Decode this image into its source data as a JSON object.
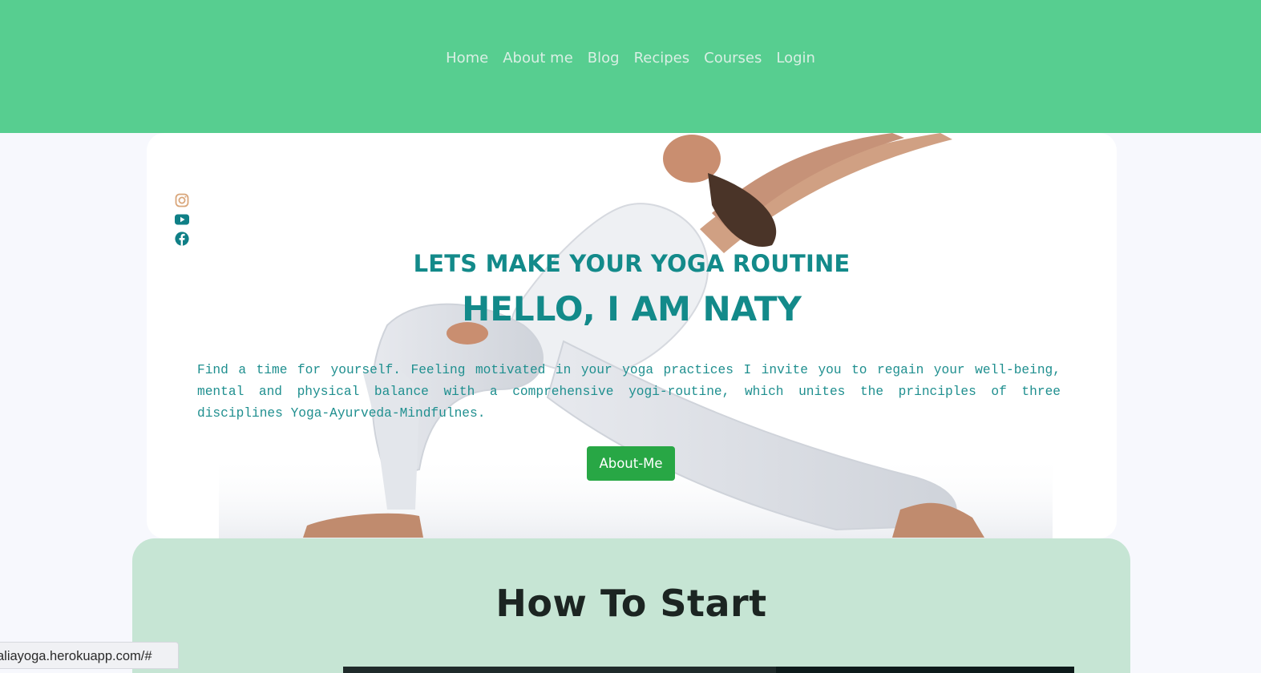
{
  "nav": {
    "items": [
      {
        "label": "Home"
      },
      {
        "label": "About me"
      },
      {
        "label": "Blog"
      },
      {
        "label": "Recipes"
      },
      {
        "label": "Courses"
      },
      {
        "label": "Login"
      }
    ]
  },
  "hero": {
    "social_icons": [
      "instagram-icon",
      "youtube-icon",
      "facebook-icon"
    ],
    "subtitle": "LETS MAKE YOUR YOGA ROUTINE",
    "title": "HELLO, I AM NATY",
    "intro": "Find a time for yourself. Feeling motivated in your yoga practices I invite you to regain your well-being, mental and physical balance with a comprehensive yogi-routine, which unites the principles of three disciplines Yoga-Ayurveda-Mindfulnes.",
    "button_label": "About-Me"
  },
  "section": {
    "title": "How To Start"
  },
  "status_bar": {
    "url": "aliayoga.herokuapp.com/#"
  },
  "colors": {
    "header_green": "#57ce90",
    "nav_text": "#d9efe4",
    "teal_text": "#138a8a",
    "button_green": "#28a745",
    "panel_mint": "#c6e5d4",
    "instagram": "#d9a67a",
    "teal_icon": "#0f7f86"
  }
}
